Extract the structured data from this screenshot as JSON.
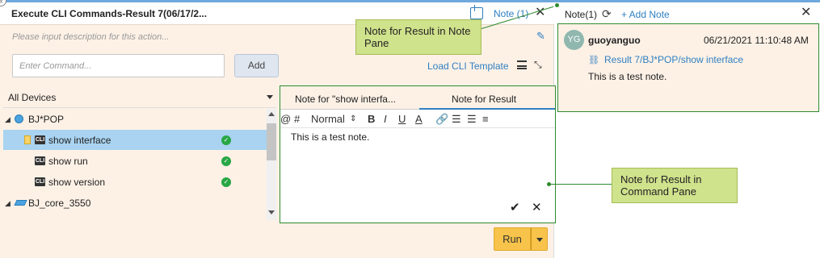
{
  "header": {
    "title": "Execute CLI Commands-Result 7(06/17/2...",
    "note_link": "Note (1)"
  },
  "description": {
    "placeholder": "Please input description for this action..."
  },
  "command": {
    "placeholder": "Enter Command...",
    "add_label": "Add",
    "load_template": "Load CLI Template"
  },
  "devices": {
    "filter_label": "All Devices",
    "tree": [
      {
        "label": "BJ*POP",
        "type": "device"
      },
      {
        "label": "show interface",
        "type": "cli",
        "selected": true,
        "status": "success"
      },
      {
        "label": "show run",
        "type": "cli",
        "status": "success"
      },
      {
        "label": "show version",
        "type": "cli",
        "status": "success"
      },
      {
        "label": "BJ_core_3550",
        "type": "switch"
      }
    ]
  },
  "editor": {
    "tabs": [
      "Note for \"show interfa...",
      "Note for Result"
    ],
    "active_tab": "Note for Result",
    "toolbar": {
      "at": "@",
      "hash": "#",
      "style_select": "Normal",
      "bold": "B",
      "italic": "I",
      "underline": "U",
      "color": "A"
    },
    "content": "This is a test note."
  },
  "run": {
    "label": "Run"
  },
  "note_pane": {
    "title": "Note(1)",
    "add_note": "+ Add Note",
    "note": {
      "avatar": "YG",
      "author": "guoyanguo",
      "date": "06/21/2021 11:10:48 AM",
      "link": "Result 7/BJ*POP/show interface",
      "body": "This is a test note."
    }
  },
  "callouts": {
    "note_pane": "Note for Result in Note Pane",
    "command_pane": "Note for Result in Command Pane"
  },
  "colors": {
    "accent": "#2f7fc1",
    "panel_bg": "#fdf1e6",
    "callout": "#cfe28c",
    "run": "#f7c34a",
    "success": "#28a745",
    "highlight_border": "#2e8b2e"
  }
}
